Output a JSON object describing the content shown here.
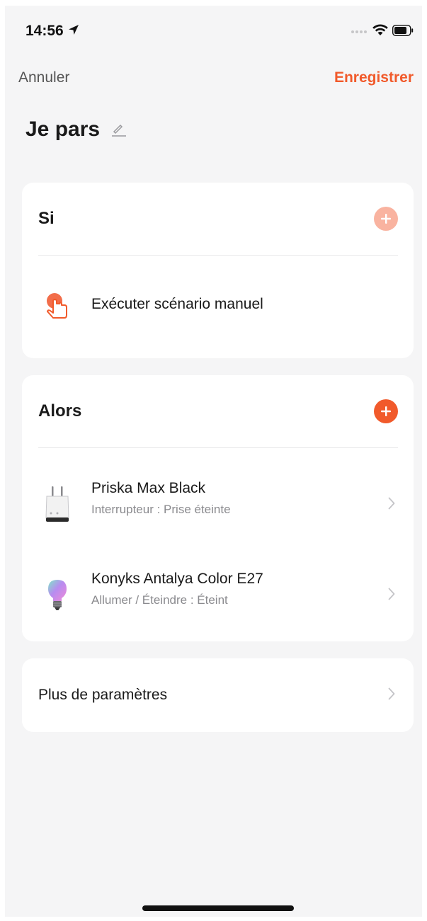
{
  "status_bar": {
    "time": "14:56",
    "location_icon": "location-arrow-icon",
    "wifi_icon": "wifi-icon",
    "battery_icon": "battery-icon"
  },
  "nav": {
    "cancel_label": "Annuler",
    "save_label": "Enregistrer"
  },
  "scene": {
    "title": "Je pars",
    "edit_icon": "pencil-icon"
  },
  "if_section": {
    "title": "Si",
    "add_icon": "plus-icon",
    "conditions": [
      {
        "label": "Exécuter scénario manuel",
        "icon": "hand-tap-icon"
      }
    ]
  },
  "then_section": {
    "title": "Alors",
    "add_icon": "plus-icon",
    "actions": [
      {
        "name": "Priska Max Black",
        "detail": "Interrupteur : Prise éteinte",
        "icon": "smart-plug-icon"
      },
      {
        "name": "Konyks Antalya Color E27",
        "detail": "Allumer / Éteindre : Éteint",
        "icon": "color-bulb-icon"
      }
    ]
  },
  "more_settings": {
    "label": "Plus de paramètres"
  },
  "colors": {
    "accent": "#f15a2b",
    "accent_light": "#f9b3a0",
    "background": "#f5f5f6",
    "card": "#ffffff"
  }
}
